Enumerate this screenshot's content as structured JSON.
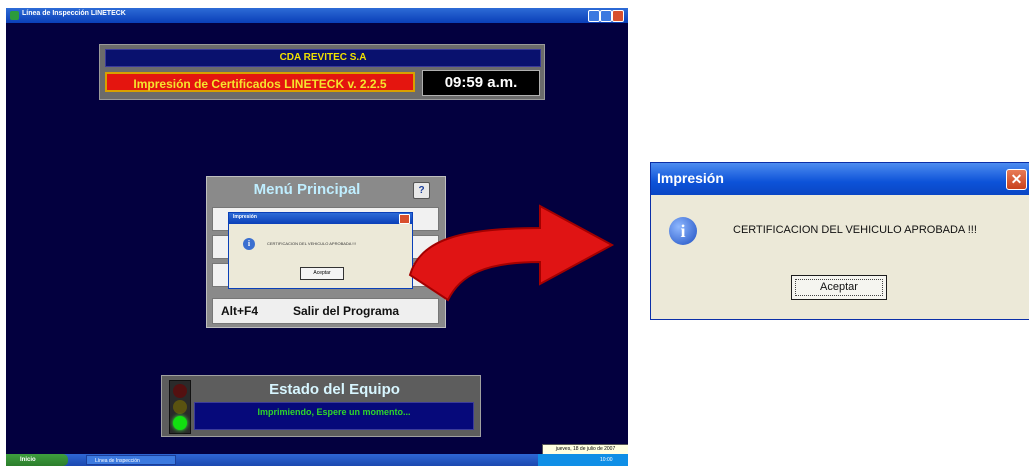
{
  "window": {
    "title": "Línea de Inspección LINETECK",
    "controls": [
      "minimize",
      "maximize",
      "close"
    ]
  },
  "header": {
    "company": "CDA REVITEC S.A",
    "app_version": "Impresión de Certificados LINETECK v. 2.2.5",
    "clock": "09:59 a.m."
  },
  "menu": {
    "title": "Menú Principal",
    "help_icon": "?",
    "exit_key": "Alt+F4",
    "exit_label": "Salir del Programa"
  },
  "small_dialog": {
    "title": "Impresión",
    "message": "CERTIFICACION DEL VEHICULO APROBADA !!!",
    "ok_label": "Aceptar"
  },
  "status": {
    "title": "Estado del Equipo",
    "message": "Imprimiendo, Espere un momento...",
    "active_light": "green"
  },
  "taskbar": {
    "start_label": "Inicio",
    "task_label": "Línea de Inspección",
    "tray_time": "10:00",
    "date_tooltip": "jueves, 18 de julio de 2007"
  },
  "dialog": {
    "title": "Impresión",
    "close_glyph": "✕",
    "icon_glyph": "i",
    "message": "CERTIFICACION DEL VEHICULO APROBADA !!!",
    "ok_label": "Aceptar"
  },
  "colors": {
    "desktop_bg": "#03003f",
    "arrow": "#e01414",
    "status_green": "#2fd62a",
    "title_yellow": "#f0e000"
  }
}
